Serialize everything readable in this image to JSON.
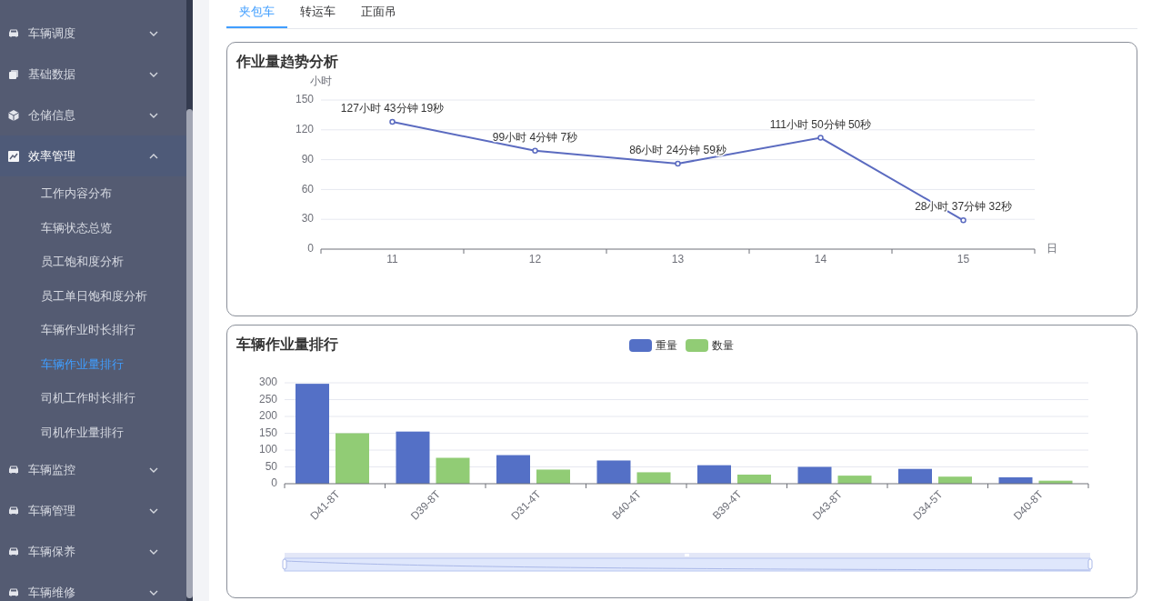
{
  "sidebar": {
    "items": [
      {
        "label": "车辆调度",
        "kind": "car",
        "expanded": false
      },
      {
        "label": "基础数据",
        "kind": "stack",
        "expanded": false
      },
      {
        "label": "仓储信息",
        "kind": "box",
        "expanded": false
      },
      {
        "label": "效率管理",
        "kind": "chart",
        "expanded": true,
        "children": [
          {
            "label": "工作内容分布",
            "selected": false
          },
          {
            "label": "车辆状态总览",
            "selected": false
          },
          {
            "label": "员工饱和度分析",
            "selected": false
          },
          {
            "label": "员工单日饱和度分析",
            "selected": false
          },
          {
            "label": "车辆作业时长排行",
            "selected": false
          },
          {
            "label": "车辆作业量排行",
            "selected": true
          },
          {
            "label": "司机工作时长排行",
            "selected": false
          },
          {
            "label": "司机作业量排行",
            "selected": false
          }
        ]
      },
      {
        "label": "车辆监控",
        "kind": "car",
        "expanded": false
      },
      {
        "label": "车辆管理",
        "kind": "car",
        "expanded": false
      },
      {
        "label": "车辆保养",
        "kind": "car",
        "expanded": false
      },
      {
        "label": "车辆维修",
        "kind": "car",
        "expanded": false
      }
    ]
  },
  "tabs": [
    {
      "label": "夹包车",
      "selected": true
    },
    {
      "label": "转运车",
      "selected": false
    },
    {
      "label": "正面吊",
      "selected": false
    }
  ],
  "trend_card": {
    "title": "作业量趋势分析",
    "chart_data": {
      "type": "line",
      "ylabel": "小时",
      "xlabel": "日",
      "categories": [
        "11",
        "12",
        "13",
        "14",
        "15"
      ],
      "ylim": [
        0,
        150
      ],
      "yticks": [
        0,
        30,
        60,
        90,
        120,
        150
      ],
      "grid": true,
      "series": [
        {
          "color": "#5b6bc0",
          "marker": true,
          "values": [
            128,
            99,
            86,
            112,
            29
          ]
        }
      ],
      "value_labels": [
        "127小时 43分钟 19秒",
        "99小时 4分钟 7秒",
        "86小时 24分钟 59秒",
        "111小时 50分钟 50秒",
        "28小时 37分钟 32秒"
      ]
    }
  },
  "ranking_card": {
    "title": "车辆作业量排行",
    "chart_data": {
      "type": "bar",
      "categories": [
        "D41-8T",
        "D39-8T",
        "D31-4T",
        "B40-4T",
        "B39-4T",
        "D43-8T",
        "D34-5T",
        "D40-8T"
      ],
      "ylim": [
        0,
        300
      ],
      "yticks": [
        0,
        50,
        100,
        150,
        200,
        250,
        300
      ],
      "grid": true,
      "series": [
        {
          "name": "重量",
          "color": "#5470c6",
          "values": [
            297,
            155,
            85,
            69,
            55,
            50,
            44,
            19
          ]
        },
        {
          "name": "数量",
          "color": "#91cc75",
          "values": [
            150,
            77,
            42,
            34,
            27,
            24,
            21,
            9
          ]
        }
      ]
    }
  }
}
